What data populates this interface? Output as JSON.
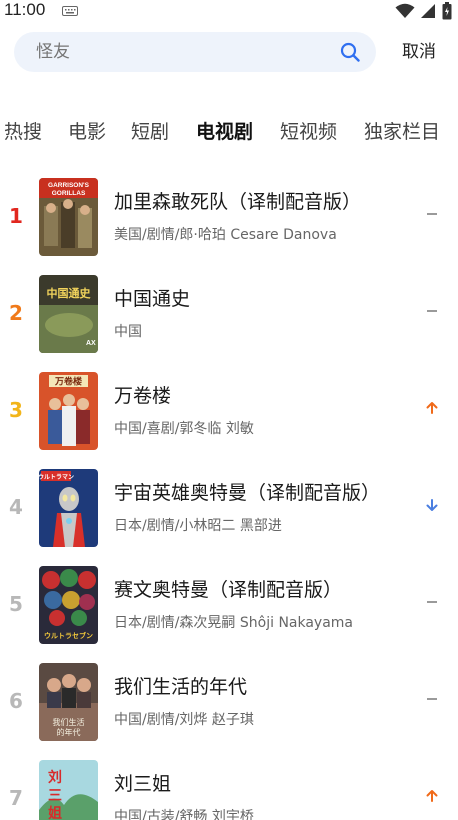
{
  "status": {
    "time": "11:00"
  },
  "search": {
    "placeholder": "怪友",
    "cancel_label": "取消"
  },
  "tabs": [
    {
      "label": "热搜"
    },
    {
      "label": "电影"
    },
    {
      "label": "短剧"
    },
    {
      "label": "电视剧",
      "active": true
    },
    {
      "label": "短视频"
    },
    {
      "label": "独家栏目"
    }
  ],
  "rankings": [
    {
      "rank": "1",
      "title": "加里森敢死队（译制配音版）",
      "meta": "美国/剧情/郎·哈珀 Cesare Danova",
      "trend": "flat",
      "poster_text": "GARRISON'S GORILLAS"
    },
    {
      "rank": "2",
      "title": "中国通史",
      "meta": "中国",
      "trend": "flat",
      "poster_text": "中国通史"
    },
    {
      "rank": "3",
      "title": "万卷楼",
      "meta": "中国/喜剧/郭冬临 刘敏",
      "trend": "up",
      "poster_text": "万卷楼"
    },
    {
      "rank": "4",
      "title": "宇宙英雄奥特曼（译制配音版）",
      "meta": "日本/剧情/小林昭二 黑部进",
      "trend": "down",
      "poster_text": "ウルトラマン"
    },
    {
      "rank": "5",
      "title": "赛文奥特曼（译制配音版）",
      "meta": "日本/剧情/森次晃嗣 Shôji Nakayama",
      "trend": "flat",
      "poster_text": "ウルトラセブン"
    },
    {
      "rank": "6",
      "title": "我们生活的年代",
      "meta": "中国/剧情/刘烨 赵子琪",
      "trend": "flat",
      "poster_text": "我们生活的年代"
    },
    {
      "rank": "7",
      "title": "刘三姐",
      "meta": "中国/古装/舒畅 刘宇桥",
      "trend": "up",
      "poster_text": "刘三姐"
    }
  ],
  "colors": {
    "up": "#f06a1a",
    "down": "#4a7ee0",
    "flat": "#9a9a9a",
    "search_bg": "#eef3fb"
  }
}
